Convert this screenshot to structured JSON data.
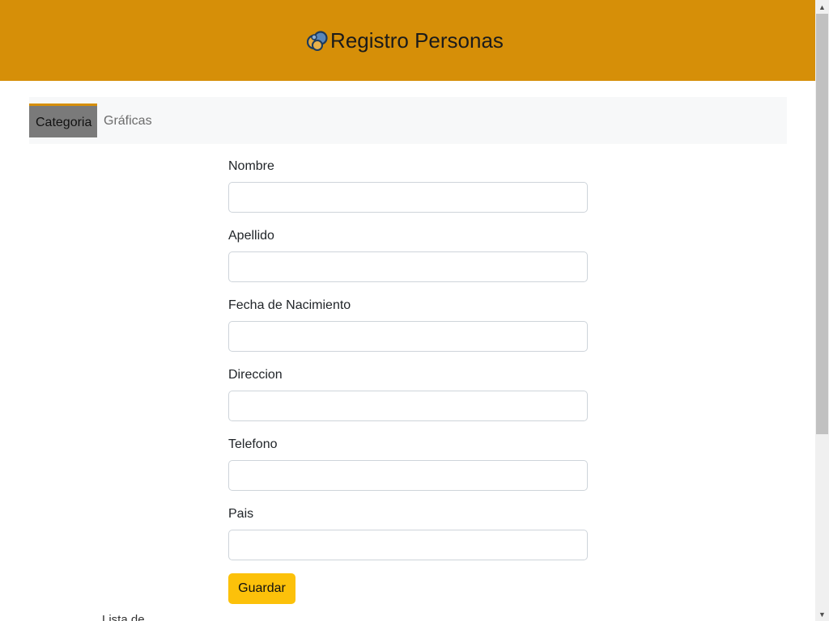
{
  "header": {
    "title": "Registro Personas",
    "background": "#d68f08",
    "logo_icon": "app-logo-icon"
  },
  "nav": {
    "tabs": [
      {
        "label": "Categoria",
        "active": true
      },
      {
        "label": "Gráficas",
        "active": false
      }
    ]
  },
  "form": {
    "fields": [
      {
        "label": "Nombre",
        "value": ""
      },
      {
        "label": "Apellido",
        "value": ""
      },
      {
        "label": "Fecha de Nacimiento",
        "value": ""
      },
      {
        "label": "Direccion",
        "value": ""
      },
      {
        "label": "Telefono",
        "value": ""
      },
      {
        "label": "Pais",
        "value": ""
      }
    ],
    "save_label": "Guardar",
    "save_color": "#fcc10a"
  },
  "list": {
    "title": "Lista de"
  },
  "scrollbar": {
    "up_icon": "scroll-up-arrow-icon",
    "down_icon": "scroll-down-arrow-icon"
  }
}
